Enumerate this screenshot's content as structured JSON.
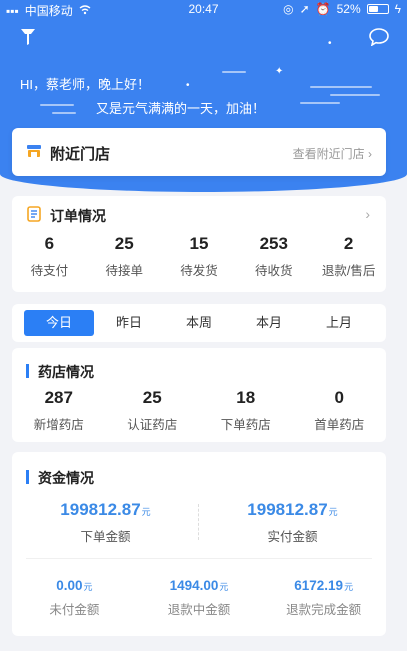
{
  "status": {
    "carrier": "中国移动",
    "time": "20:47",
    "battery": "52%",
    "battery_level": 0.52
  },
  "header": {
    "greeting": "HI，蔡老师，晚上好！",
    "subgreeting": "又是元气满满的一天，加油！"
  },
  "store": {
    "title": "附近门店",
    "link": "查看附近门店 ›"
  },
  "orders": {
    "title": "订单情况",
    "items": [
      {
        "value": "6",
        "label": "待支付"
      },
      {
        "value": "25",
        "label": "待接单"
      },
      {
        "value": "15",
        "label": "待发货"
      },
      {
        "value": "253",
        "label": "待收货"
      },
      {
        "value": "2",
        "label": "退款/售后"
      }
    ]
  },
  "tabs": [
    "今日",
    "昨日",
    "本周",
    "本月",
    "上月"
  ],
  "pharmacy": {
    "title": "药店情况",
    "items": [
      {
        "value": "287",
        "label": "新增药店"
      },
      {
        "value": "25",
        "label": "认证药店"
      },
      {
        "value": "18",
        "label": "下单药店"
      },
      {
        "value": "0",
        "label": "首单药店"
      }
    ]
  },
  "money": {
    "title": "资金情况",
    "unit": "元",
    "top": [
      {
        "value": "199812.87",
        "label": "下单金额"
      },
      {
        "value": "199812.87",
        "label": "实付金额"
      }
    ],
    "bottom": [
      {
        "value": "0.00",
        "label": "未付金额"
      },
      {
        "value": "1494.00",
        "label": "退款中金额"
      },
      {
        "value": "6172.19",
        "label": "退款完成金额"
      }
    ]
  },
  "colors": {
    "primary": "#3b82f0",
    "accent": "#2b7ff5",
    "amount": "#3b8ae6",
    "background": "#f2f3f7"
  }
}
